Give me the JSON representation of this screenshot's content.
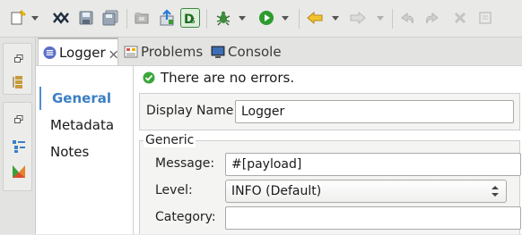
{
  "toolbar": {
    "icons": [
      "new-icon",
      "mule-icon",
      "save-icon",
      "save-all-icon",
      "folder-icon",
      "deploy-icon",
      "dataweave-icon",
      "debug-icon",
      "run-icon",
      "back-icon",
      "forward-icon",
      "undo-icon",
      "redo-icon",
      "delete-icon",
      "select-all-icon"
    ]
  },
  "tabs": [
    {
      "label": "Logger",
      "active": true
    },
    {
      "label": "Problems",
      "active": false
    },
    {
      "label": "Console",
      "active": false
    }
  ],
  "nav": {
    "items": [
      "General",
      "Metadata",
      "Notes"
    ],
    "selected": "General"
  },
  "status": {
    "message": "There are no errors."
  },
  "form": {
    "display_name_label": "Display Name:",
    "display_name_value": "Logger",
    "group_title": "Generic",
    "message_label": "Message:",
    "message_value": "#[payload]",
    "level_label": "Level:",
    "level_value": "INFO (Default)",
    "category_label": "Category:",
    "category_value": ""
  },
  "colors": {
    "accent": "#3b7fc4",
    "ok_green": "#3aa63a",
    "run_green": "#2e9b2e",
    "back_yellow": "#e6a817"
  }
}
